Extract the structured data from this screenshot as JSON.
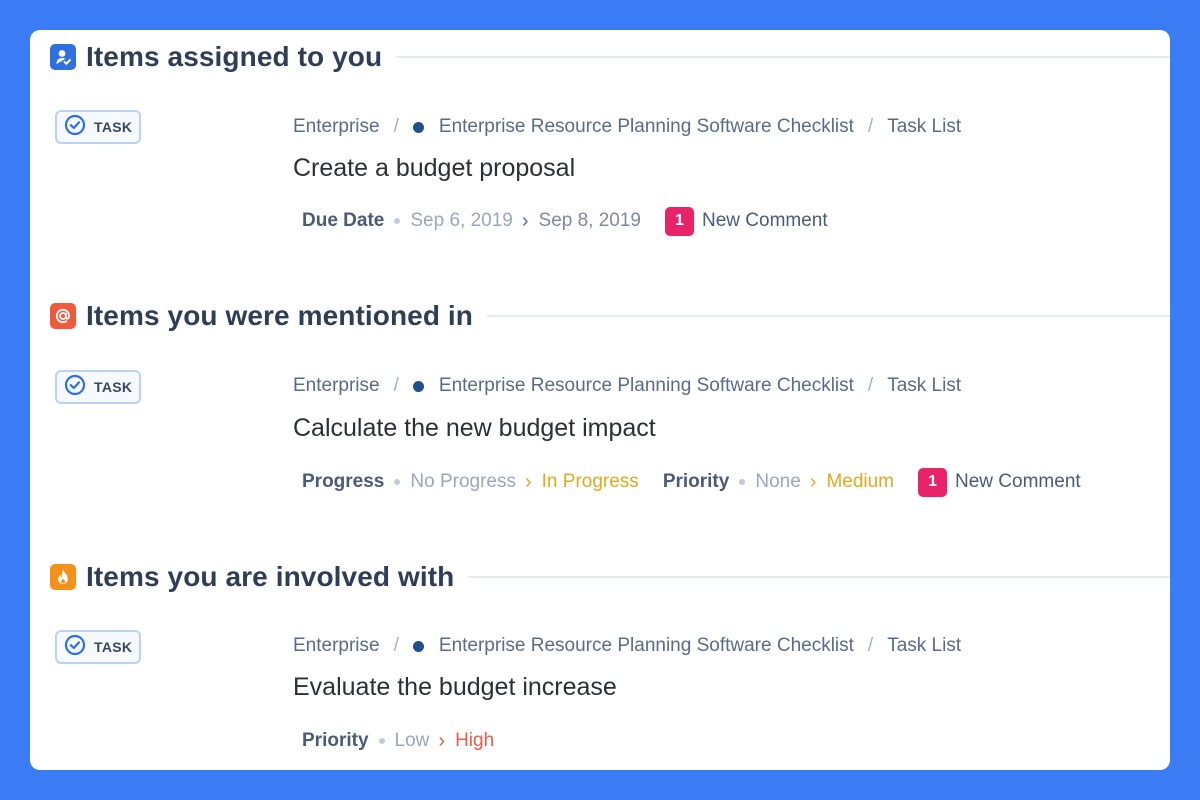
{
  "colors": {
    "background": "#3b7cf5",
    "assigned_icon": "#2f6fdf",
    "mentioned_icon": "#f05a3c",
    "involved_icon": "#f5901a",
    "comment_badge": "#e8236a",
    "in_progress": "#e0a91f",
    "medium": "#e0a91f",
    "high": "#ea5a48"
  },
  "sections": [
    {
      "title": "Items assigned to you",
      "icon": "user-check-icon",
      "item": {
        "type_label": "TASK",
        "breadcrumb": [
          "Enterprise",
          "Enterprise Resource Planning Software Checklist",
          "Task List"
        ],
        "title": "Create a budget proposal",
        "meta": {
          "label": "Due Date",
          "from": "Sep 6, 2019",
          "to": "Sep 8, 2019"
        },
        "comments": {
          "count": "1",
          "label": "New Comment"
        }
      }
    },
    {
      "title": "Items you were mentioned in",
      "icon": "at-sign-icon",
      "item": {
        "type_label": "TASK",
        "breadcrumb": [
          "Enterprise",
          "Enterprise Resource Planning Software Checklist",
          "Task List"
        ],
        "title": "Calculate the new budget impact",
        "progress": {
          "label": "Progress",
          "from": "No Progress",
          "to": "In Progress"
        },
        "priority": {
          "label": "Priority",
          "from": "None",
          "to": "Medium"
        },
        "comments": {
          "count": "1",
          "label": "New Comment"
        }
      }
    },
    {
      "title": "Items you are involved with",
      "icon": "flame-icon",
      "item": {
        "type_label": "TASK",
        "breadcrumb": [
          "Enterprise",
          "Enterprise Resource Planning Software Checklist",
          "Task List"
        ],
        "title": "Evaluate the budget increase",
        "priority": {
          "label": "Priority",
          "from": "Low",
          "to": "High"
        }
      }
    }
  ]
}
